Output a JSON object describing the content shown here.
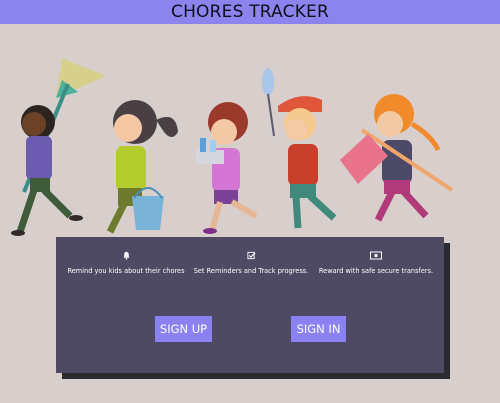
{
  "header": {
    "title": "CHORES TRACKER"
  },
  "features": [
    {
      "icon": "bell-icon",
      "text": "Remind you kids about their chores"
    },
    {
      "icon": "checkbox-icon",
      "text": "Set Reminders and Track progress."
    },
    {
      "icon": "money-icon",
      "text": "Reward with safe secure transfers."
    }
  ],
  "actions": {
    "sign_up_label": "SIGN UP",
    "sign_in_label": "SIGN IN"
  },
  "colors": {
    "background": "#d8cfcd",
    "header": "#8b84ee",
    "panel": "#4e4a63",
    "panel_shadow": "#2a2b30",
    "button": "#8a82f0"
  },
  "illustration": {
    "subject": "children-carrying-cleaning-tools"
  }
}
